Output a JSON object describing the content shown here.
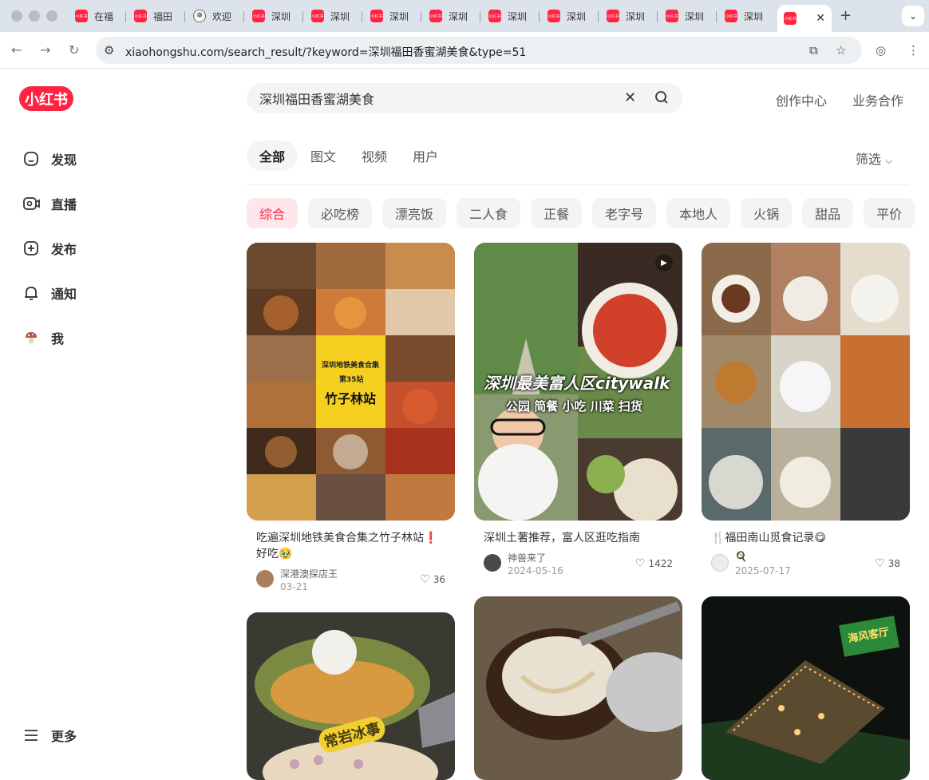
{
  "browser": {
    "tabs": [
      {
        "label": "在福",
        "icon": "xiaohongshu-favicon"
      },
      {
        "label": "福田",
        "icon": "xiaohongshu-favicon"
      },
      {
        "label": "欢迎",
        "icon": "chatgpt-favicon"
      },
      {
        "label": "深圳",
        "icon": "xiaohongshu-favicon"
      },
      {
        "label": "深圳",
        "icon": "xiaohongshu-favicon"
      },
      {
        "label": "深圳",
        "icon": "xiaohongshu-favicon"
      },
      {
        "label": "深圳",
        "icon": "xiaohongshu-favicon"
      },
      {
        "label": "深圳",
        "icon": "xiaohongshu-favicon"
      },
      {
        "label": "深圳",
        "icon": "xiaohongshu-favicon"
      },
      {
        "label": "深圳",
        "icon": "xiaohongshu-favicon"
      },
      {
        "label": "深圳",
        "icon": "xiaohongshu-favicon"
      },
      {
        "label": "深圳",
        "icon": "xiaohongshu-favicon"
      }
    ],
    "active_tab_label": "",
    "url": "xiaohongshu.com/search_result/?keyword=深圳福田香蜜湖美食&type=51",
    "favicon_text": "小红书"
  },
  "brand": {
    "logo_text": "小红书",
    "color": "#ff2442"
  },
  "sidebar": {
    "items": [
      {
        "label": "发现",
        "icon": "home-icon"
      },
      {
        "label": "直播",
        "icon": "live-icon"
      },
      {
        "label": "发布",
        "icon": "plus-square-icon"
      },
      {
        "label": "通知",
        "icon": "bell-icon"
      },
      {
        "label": "我",
        "icon": "avatar-mushroom-icon"
      }
    ],
    "more_label": "更多"
  },
  "search": {
    "value": "深圳福田香蜜湖美食"
  },
  "header_links": {
    "creator": "创作中心",
    "business": "业务合作"
  },
  "content_tabs": [
    "全部",
    "图文",
    "视频",
    "用户"
  ],
  "filter_label": "筛选",
  "chips": [
    "综合",
    "必吃榜",
    "漂亮饭",
    "二人食",
    "正餐",
    "老字号",
    "本地人",
    "火锅",
    "甜品",
    "平价"
  ],
  "cards": [
    {
      "title": "吃遍深圳地铁美食合集之竹子林站❗好吃🥹",
      "author": "深港澳探店王",
      "date": "03-21",
      "likes": "36",
      "cover_text": {
        "line1": "深圳地铁美食合集",
        "line2": "第35站",
        "line3": "竹子林站"
      }
    },
    {
      "title": "深圳土著推荐，富人区逛吃指南",
      "author": "神兽来了",
      "date": "2024-05-16",
      "likes": "1422",
      "cover_text": {
        "line1": "深圳最美富人区citywalk",
        "line2": "公园 简餐 小吃 川菜 扫货"
      }
    },
    {
      "title": "🍴福田南山觅食记录😋",
      "author": "🍳",
      "date": "2025-07-17",
      "likes": "38"
    },
    {
      "cover_text": {
        "line1": "常岩冰事"
      }
    },
    {},
    {
      "cover_text": {
        "line1": "海风客厅"
      }
    }
  ]
}
